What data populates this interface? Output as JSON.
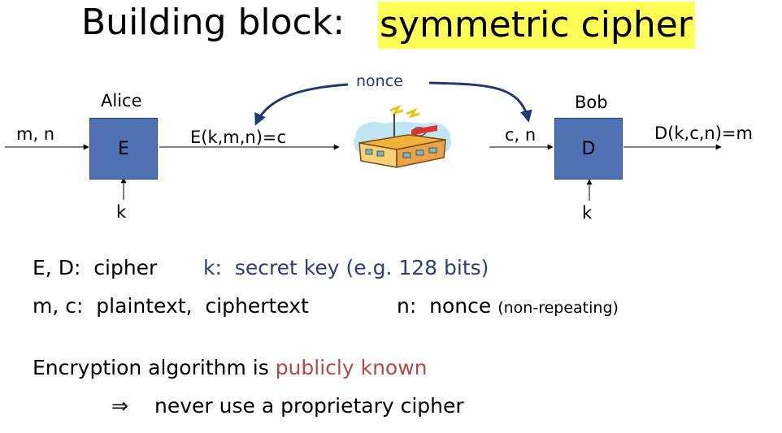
{
  "title": {
    "prefix": "Building block:",
    "highlight": "symmetric cipher"
  },
  "diagram": {
    "nonce_label": "nonce",
    "alice": {
      "name": "Alice",
      "box": "E",
      "input": "m, n",
      "key": "k",
      "output": "E(k,m,n)=c"
    },
    "bob": {
      "name": "Bob",
      "box": "D",
      "input": "c, n",
      "key": "k",
      "output": "D(k,c,n)=m"
    },
    "channel_icon": "radio-station-icon",
    "colors": {
      "box": "#4f72b5",
      "nonce_arrow": "#1f3a6e",
      "highlight": "#ffff55"
    }
  },
  "definitions": {
    "ed": "E, D:  cipher",
    "key": "k:  secret key (e.g. 128 bits)",
    "mc": "m, c:  plaintext,  ciphertext",
    "nonce_main": "n:  nonce ",
    "nonce_note": "(non-repeating)"
  },
  "note": {
    "prefix": "Encryption algorithm is ",
    "emphasis": "publicly known",
    "implies_symbol": "⇒",
    "consequence": "never use a proprietary cipher"
  }
}
